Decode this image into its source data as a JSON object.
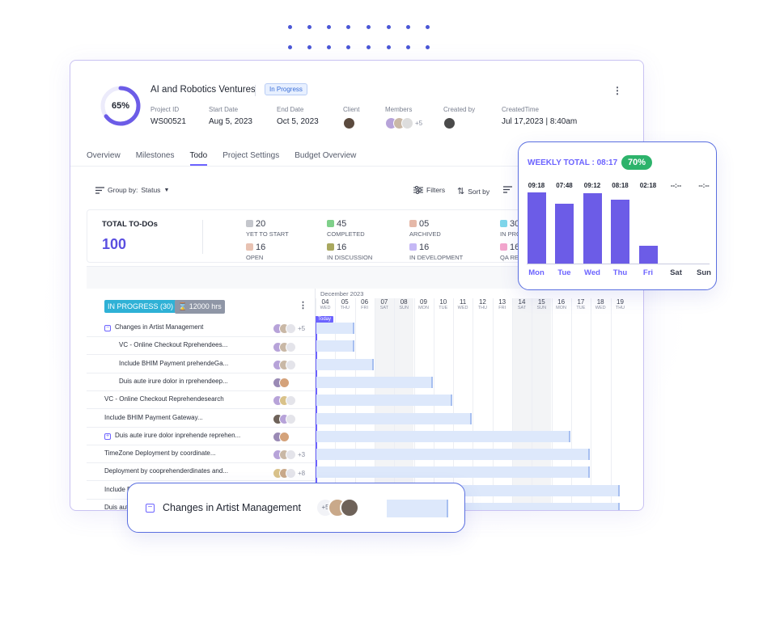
{
  "project": {
    "progress_label": "65%",
    "progress": 0.65,
    "title": "AI and Robotics Ventures",
    "status": "In Progress",
    "meta": [
      {
        "label": "Project ID",
        "value": "WS00521"
      },
      {
        "label": "Start Date",
        "value": "Aug 5, 2023"
      },
      {
        "label": "End Date",
        "value": "Oct 5, 2023"
      },
      {
        "label": "Client",
        "value": ""
      },
      {
        "label": "Members",
        "value": "+5"
      },
      {
        "label": "Created by",
        "value": ""
      },
      {
        "label": "CreatedTime",
        "value": "Jul 17,2023 | 8:40am"
      }
    ]
  },
  "tabs": [
    {
      "label": "Overview"
    },
    {
      "label": "Milestones"
    },
    {
      "label": "Todo"
    },
    {
      "label": "Project Settings"
    },
    {
      "label": "Budget Overview"
    }
  ],
  "toolbar": {
    "group_by": "Group by:",
    "group_value": "Status",
    "filters": "Filters",
    "sort_by": "Sort by"
  },
  "summary": {
    "total_label": "TOTAL TO-DOs",
    "total_value": "100",
    "stats": [
      {
        "num": "20",
        "name": "YET TO START",
        "color": "#c4c6cc"
      },
      {
        "num": "45",
        "name": "COMPLETED",
        "color": "#7fd08a"
      },
      {
        "num": "05",
        "name": "ARCHIVED",
        "color": "#e5b8a8"
      },
      {
        "num": "30",
        "name": "IN PRO",
        "color": "#7fd6ea"
      },
      {
        "num": "16",
        "name": "OPEN",
        "color": "#e8c2b2"
      },
      {
        "num": "16",
        "name": "IN DISCUSSION",
        "color": "#a9a85f"
      },
      {
        "num": "16",
        "name": "IN DEVELOPMENT",
        "color": "#c5b8f5"
      },
      {
        "num": "16",
        "name": "QA RE",
        "color": "#f3a6cd"
      }
    ]
  },
  "board": {
    "group_label": "IN PROGRESS (30)",
    "hours_label": "⌛ 12000 hrs",
    "month": "December 2023",
    "today": "Today",
    "days": [
      {
        "d": "04",
        "w": "WED"
      },
      {
        "d": "05",
        "w": "THU"
      },
      {
        "d": "06",
        "w": "FRI"
      },
      {
        "d": "07",
        "w": "SAT"
      },
      {
        "d": "08",
        "w": "SUN"
      },
      {
        "d": "09",
        "w": "MON"
      },
      {
        "d": "10",
        "w": "TUE"
      },
      {
        "d": "11",
        "w": "WED"
      },
      {
        "d": "12",
        "w": "THU"
      },
      {
        "d": "13",
        "w": "FRI"
      },
      {
        "d": "14",
        "w": "SAT"
      },
      {
        "d": "15",
        "w": "SUN"
      },
      {
        "d": "16",
        "w": "MON"
      },
      {
        "d": "17",
        "w": "TUE"
      },
      {
        "d": "18",
        "w": "WED"
      },
      {
        "d": "19",
        "w": "THU"
      }
    ],
    "rows": [
      {
        "title": "Changes in Artist Management",
        "plus": "+5"
      },
      {
        "title": "VC - Online Checkout Rprehendees...",
        "plus": ""
      },
      {
        "title": "Include BHIM Payment prehendeGa...",
        "plus": ""
      },
      {
        "title": "Duis aute irure dolor in rprehendeep...",
        "plus": ""
      },
      {
        "title": "VC - Online Checkout Reprehendesearch",
        "plus": ""
      },
      {
        "title": "Include BHIM Payment Gateway...",
        "plus": ""
      },
      {
        "title": "Duis aute irure dolor inprehende reprehen...",
        "plus": ""
      },
      {
        "title": "TimeZone Deployment by coordinate...",
        "plus": "+3"
      },
      {
        "title": "Deployment by cooprehenderdinates and...",
        "plus": "+8"
      },
      {
        "title": "Include B",
        "plus": ""
      },
      {
        "title": "Duis aut",
        "plus": ""
      }
    ]
  },
  "weekly": {
    "title": "WEEKLY TOTAL :  08:17",
    "percent": "70%",
    "days": [
      {
        "day": "Mon",
        "time": "09:18",
        "value": 9.3
      },
      {
        "day": "Tue",
        "time": "07:48",
        "value": 7.8
      },
      {
        "day": "Wed",
        "time": "09:12",
        "value": 9.2
      },
      {
        "day": "Thu",
        "time": "08:18",
        "value": 8.3
      },
      {
        "day": "Fri",
        "time": "02:18",
        "value": 2.3
      },
      {
        "day": "Sat",
        "time": "--:--",
        "value": 0
      },
      {
        "day": "Sun",
        "time": "--:--",
        "value": 0
      }
    ]
  },
  "float_row": {
    "title": "Changes in Artist Management",
    "plus": "+5"
  }
}
